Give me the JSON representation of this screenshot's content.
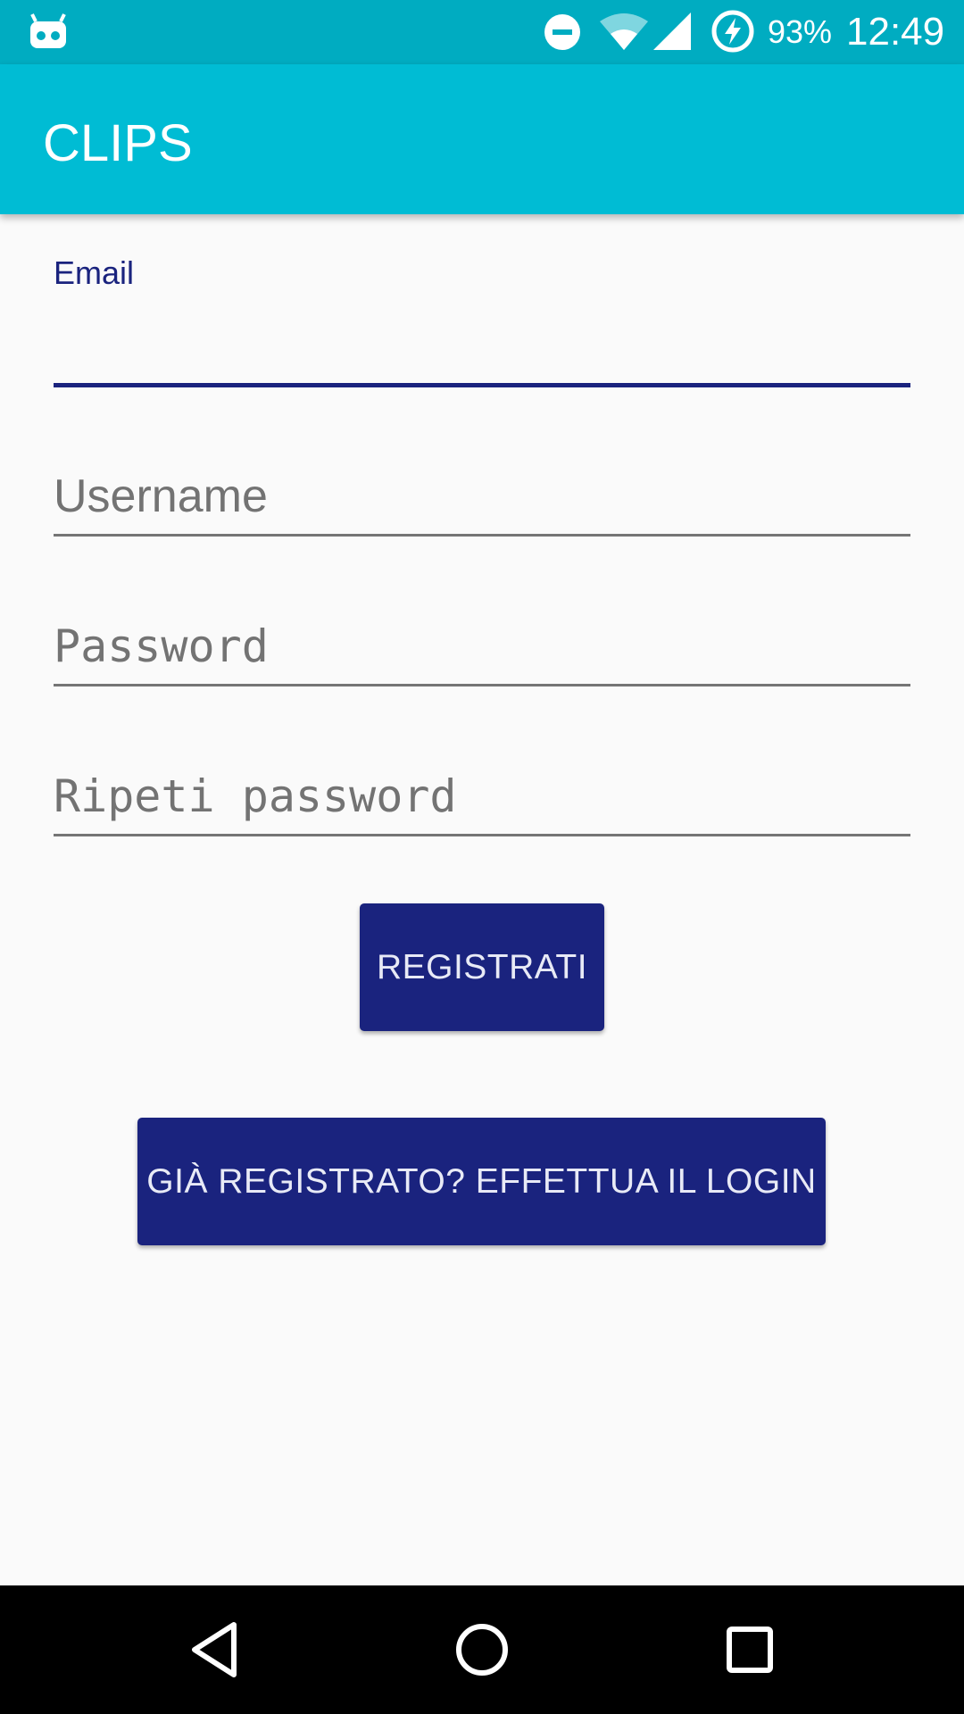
{
  "status_bar": {
    "battery_percent": "93%",
    "time": "12:49",
    "icons": [
      "android-robot-icon",
      "do-not-disturb-icon",
      "wifi-icon",
      "cell-signal-icon",
      "battery-charging-icon"
    ]
  },
  "app_bar": {
    "title": "CLIPS"
  },
  "form": {
    "email": {
      "label": "Email",
      "value": "",
      "focused": true
    },
    "username": {
      "placeholder": "Username",
      "value": ""
    },
    "password": {
      "placeholder": "Password",
      "value": ""
    },
    "repeat_password": {
      "placeholder": "Ripeti password",
      "value": ""
    }
  },
  "buttons": {
    "register": "REGISTRATI",
    "login": "GIÀ REGISTRATO? EFFETTUA IL LOGIN"
  },
  "nav_bar": {
    "icons": [
      "back-icon",
      "home-icon",
      "recents-icon"
    ]
  },
  "colors": {
    "status_bar": "#00acc1",
    "app_bar": "#00bcd4",
    "accent": "#1a237e",
    "background": "#fafafa",
    "hint_text": "#737373"
  }
}
